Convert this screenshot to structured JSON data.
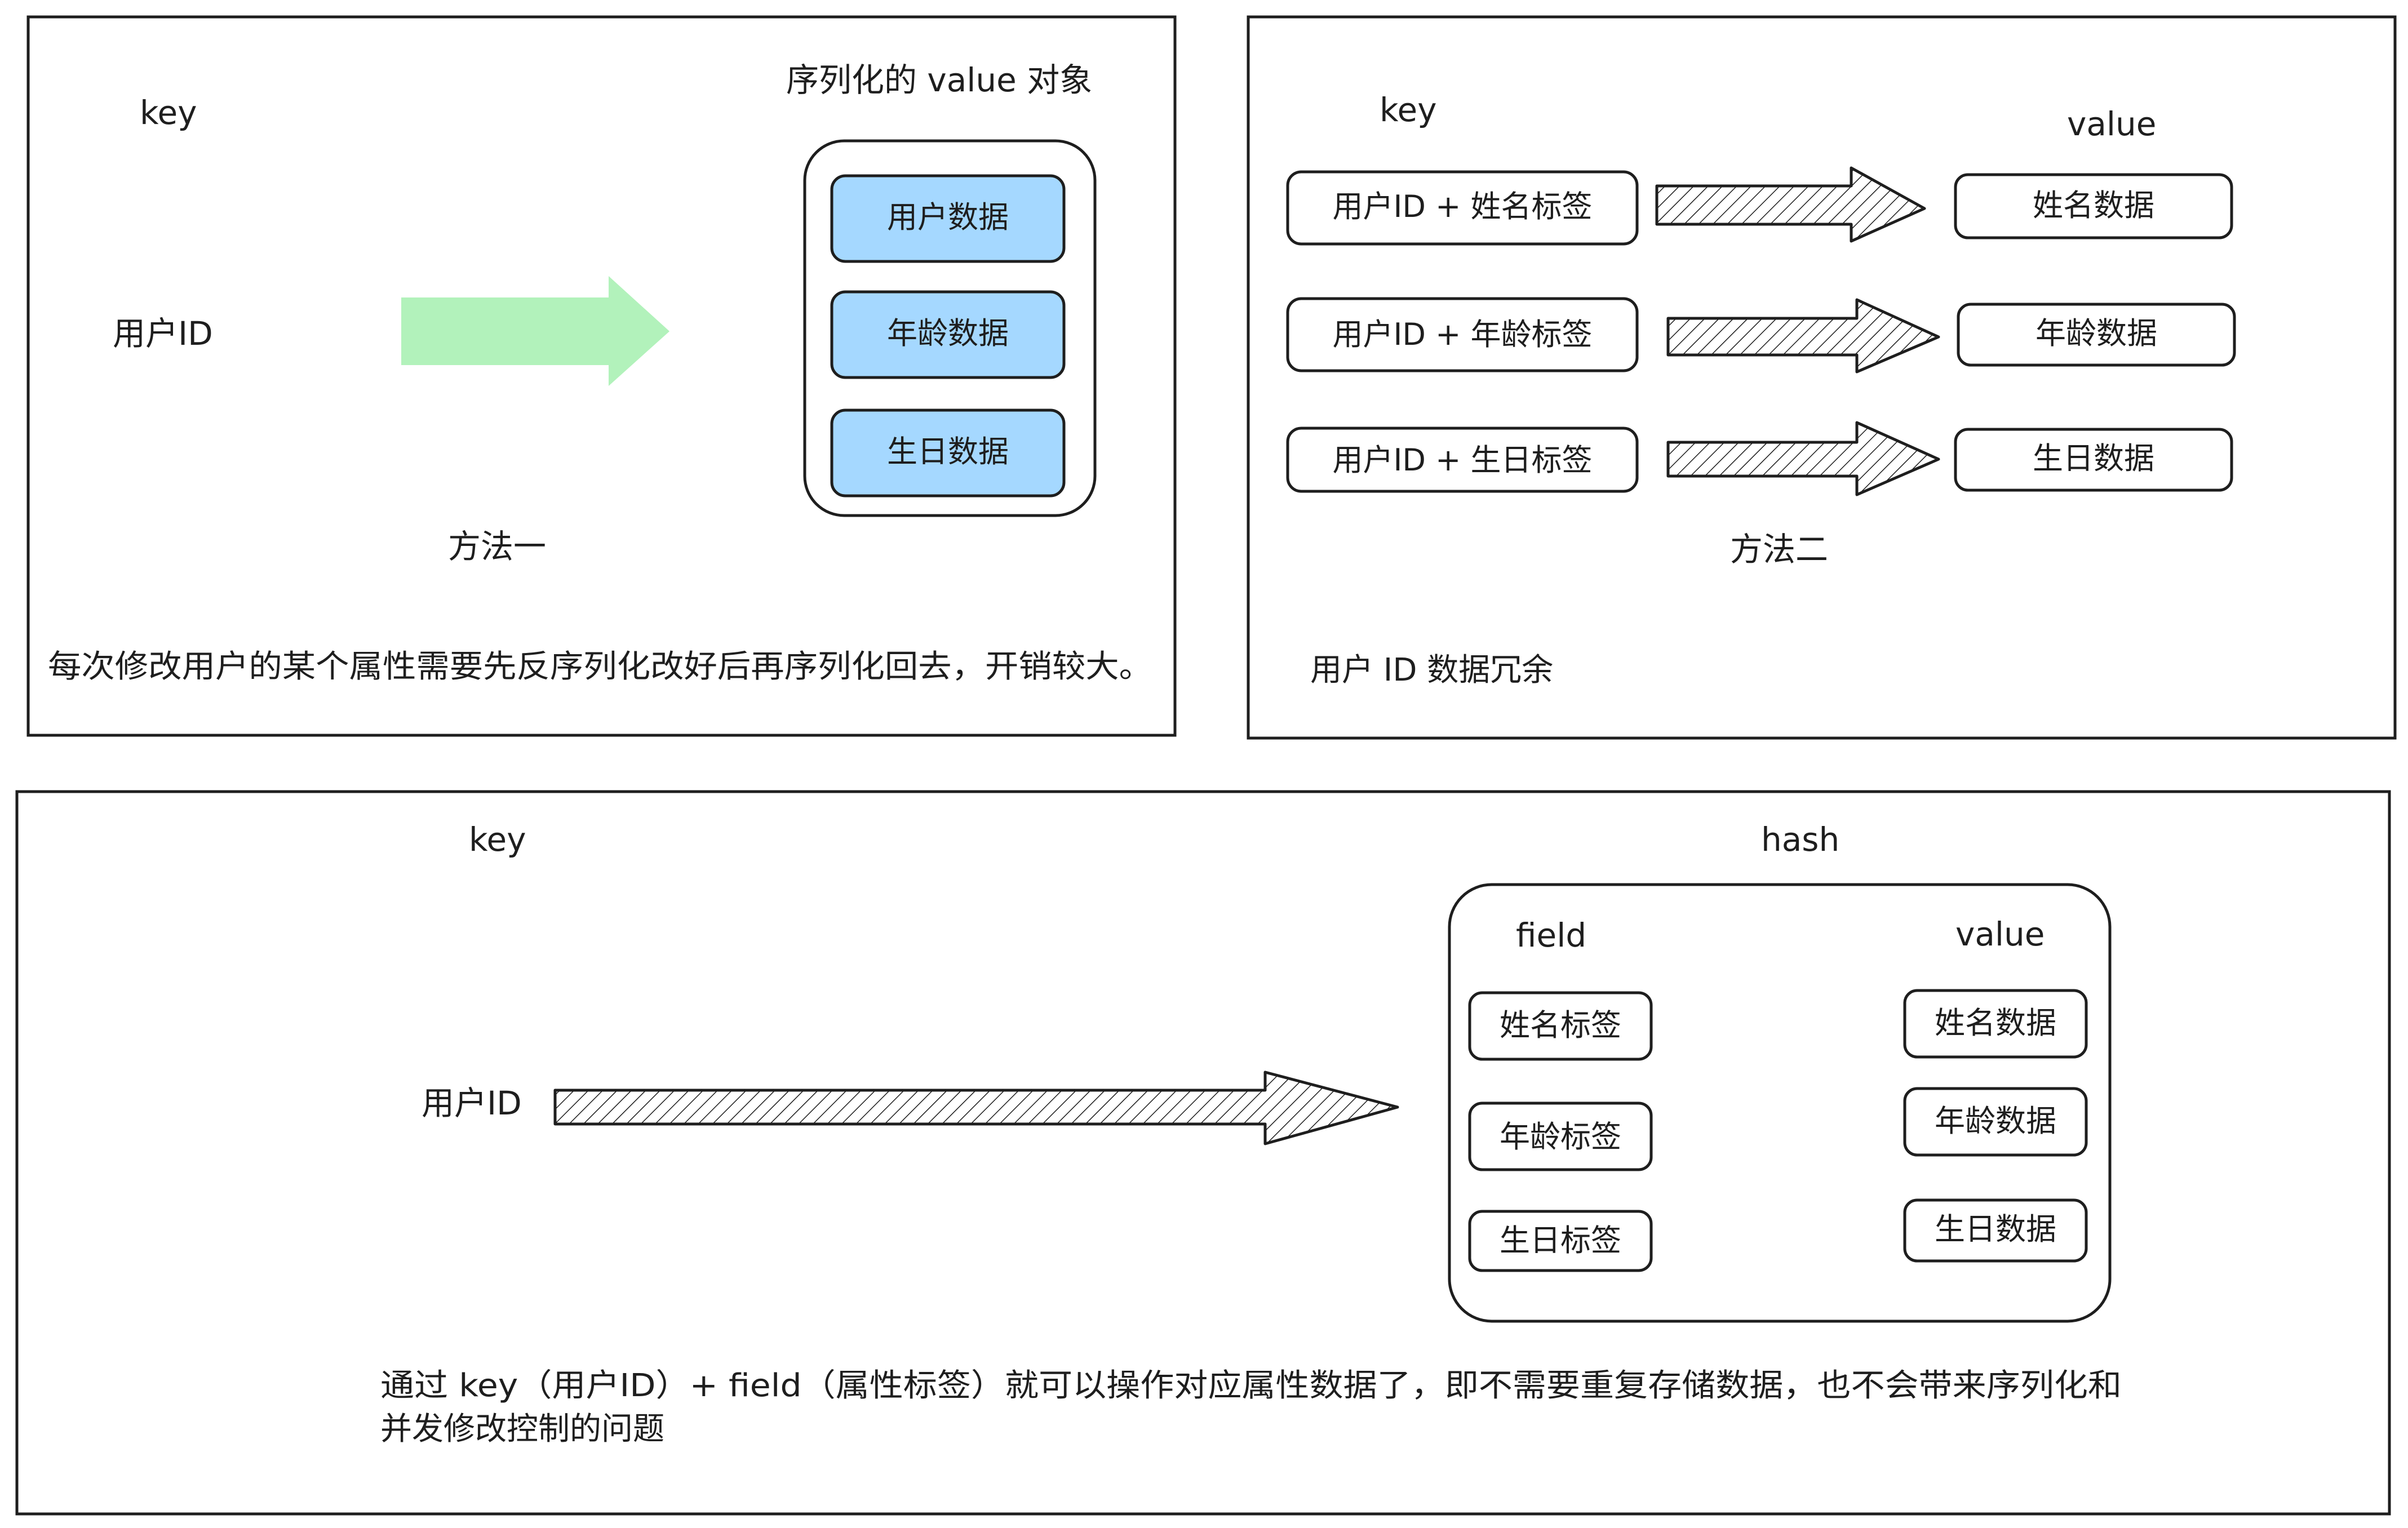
{
  "method1": {
    "key_label": "key",
    "value_title": "序列化的 value 对象",
    "key_value": "用户ID",
    "fields": [
      "用户数据",
      "年龄数据",
      "生日数据"
    ],
    "caption": "方法一",
    "note": "每次修改用户的某个属性需要先反序列化改好后再序列化回去，开销较大。",
    "colors": {
      "arrow": "#b2f2bb",
      "field_fill": "#a5d8ff"
    }
  },
  "method2": {
    "key_label": "key",
    "value_label": "value",
    "rows": [
      {
        "key": "用户ID + 姓名标签",
        "value": "姓名数据"
      },
      {
        "key": "用户ID + 年龄标签",
        "value": "年龄数据"
      },
      {
        "key": "用户ID + 生日标签",
        "value": "生日数据"
      }
    ],
    "caption": "方法二",
    "note": "用户 ID 数据冗余"
  },
  "method3": {
    "key_label": "key",
    "hash_label": "hash",
    "key_value": "用户ID",
    "field_header": "field",
    "value_header": "value",
    "fields": [
      "姓名标签",
      "年龄标签",
      "生日标签"
    ],
    "values": [
      "姓名数据",
      "年龄数据",
      "生日数据"
    ],
    "note_line1": "通过 key（用户ID）+ field（属性标签）就可以操作对应属性数据了，即不需要重复存储数据，也不会带来序列化和",
    "note_line2": "并发修改控制的问题"
  }
}
